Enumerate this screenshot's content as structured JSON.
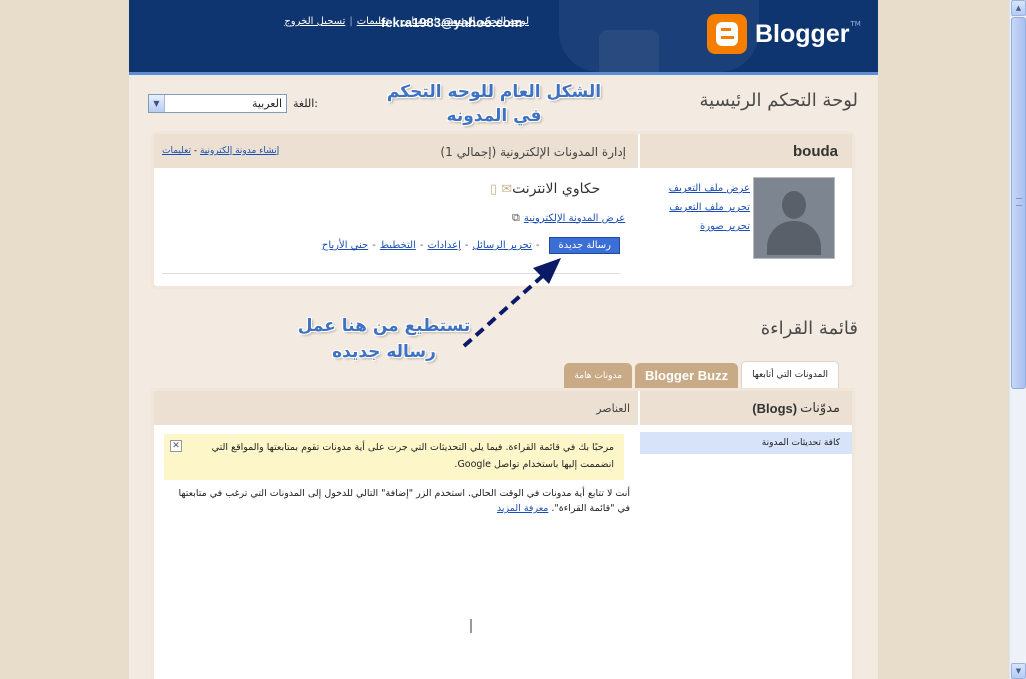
{
  "header": {
    "links": [
      "لوحة التحكم الرئيسية",
      "حسابي",
      "تعليمات",
      "تسجيل الخروج"
    ],
    "email": "fekra1983@yahoo.com",
    "logo_text": "Blogger",
    "logo_tm": "TM",
    "brand_color": "#f57d00"
  },
  "dashboard": {
    "title": "لوحة التحكم الرئيسية",
    "language_label": "اللغة:",
    "language_value": "العربية"
  },
  "annotations": {
    "top_line1": "الشكل العام للوحه التحكم",
    "top_line2": "في المدونه",
    "mid_line1": "تستطيع من هنا عمل",
    "mid_line2": "رساله جديده"
  },
  "profile": {
    "name": "bouda",
    "links": [
      "عرض ملف التعريف",
      "تحرير ملف التعريف",
      "تحرير صورة"
    ]
  },
  "blogs_panel": {
    "title": "إدارة المدونات الإلكترونية (إجمالي 1)",
    "create_link": "إنشاء مدونة إلكترونية",
    "help_link": "تعليمات",
    "blog_name": "حكاوي الانترنت",
    "view_blog": "عرض المدونة الإلكترونية",
    "new_post": "رسالة جديدة",
    "actions": [
      "تحرير الرسائل",
      "إعدادات",
      "التخطيط",
      "جني الأرباح"
    ]
  },
  "reading_list": {
    "title": "قائمة القراءة",
    "tabs": [
      "المدونات التي أتابعها",
      "Blogger Buzz",
      "مدونات هامة"
    ],
    "blogs_header_ar": "مدوّنات",
    "blogs_header_en": "(Blogs)",
    "items_header": "العناصر",
    "all_updates": "كافة تحديثات المدونة",
    "welcome_text": "مرحبًا بك في قائمة القراءة. فيما يلي التحديثات التي جرت على أية مدونات تقوم بمتابعتها والمواقع التي انضممت إليها باستخدام تواصل Google.",
    "no_follow_text": "أنت لا تتابع أية مدونات في الوقت الحالي. استخدم الزر \"إضافة\" التالي للدخول إلى المدونات التي ترغب في متابعتها في \"قائمة القراءة\".",
    "learn_more": "معرفة المزيد",
    "close_glyph": "✕"
  }
}
